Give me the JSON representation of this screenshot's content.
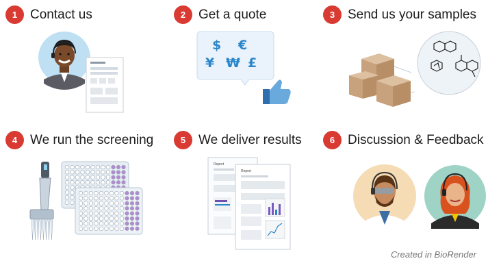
{
  "steps": [
    {
      "number": "1",
      "label": "Contact us"
    },
    {
      "number": "2",
      "label": "Get a quote"
    },
    {
      "number": "3",
      "label": "Send us your samples"
    },
    {
      "number": "4",
      "label": "We run the screening"
    },
    {
      "number": "5",
      "label": "We deliver results"
    },
    {
      "number": "6",
      "label": "Discussion & Feedback"
    }
  ],
  "currency_symbols": [
    "$",
    "€",
    "¥",
    "₩",
    "£"
  ],
  "credit": "Created in BioRender",
  "colors": {
    "badge": "#d93a32",
    "accent_blue": "#2a86c9",
    "box": "#c8a27c",
    "well_purple": "#b28ad1"
  }
}
